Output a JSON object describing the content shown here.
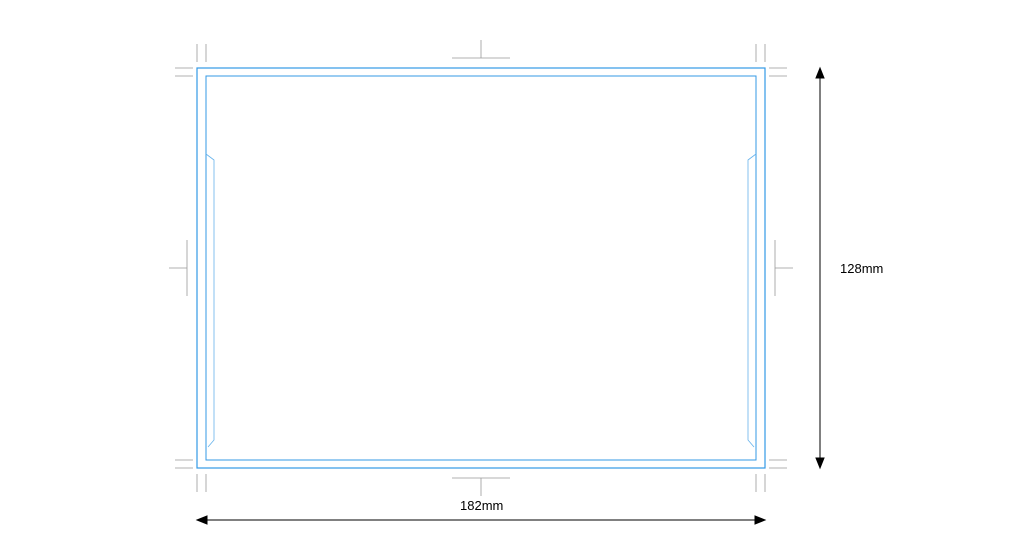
{
  "diagram": {
    "width_label": "182mm",
    "height_label": "128mm",
    "colors": {
      "outline": "#3399e6",
      "guides": "#999999",
      "arrows": "#000000"
    }
  }
}
